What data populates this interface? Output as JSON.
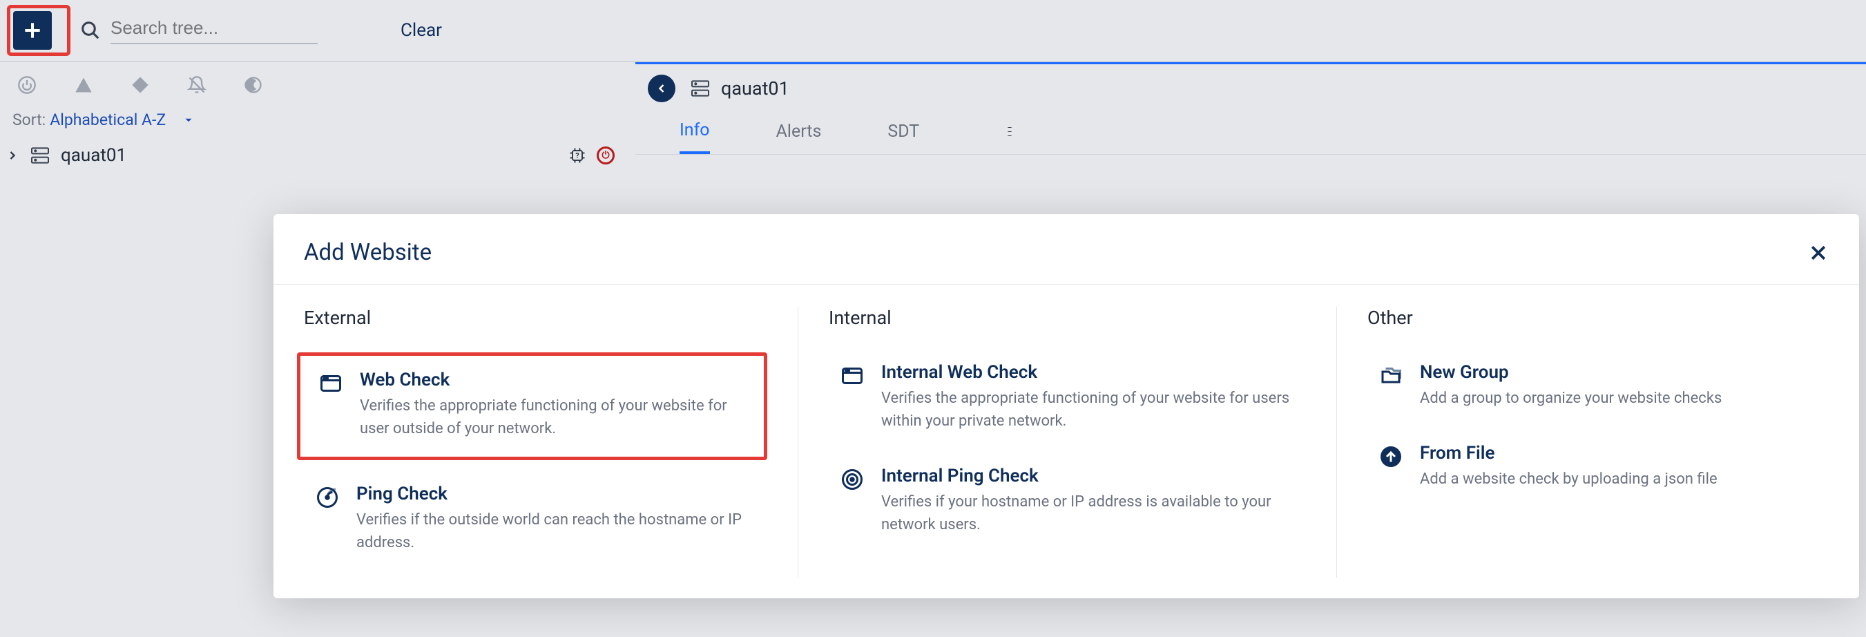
{
  "toolbar": {
    "search_placeholder": "Search tree...",
    "clear_label": "Clear"
  },
  "sort": {
    "label": "Sort:",
    "value": "Alphabetical A-Z"
  },
  "tree": {
    "items": [
      {
        "label": "qauat01"
      }
    ]
  },
  "main": {
    "title": "qauat01",
    "tabs": [
      {
        "label": "Info",
        "active": true
      },
      {
        "label": "Alerts",
        "active": false
      },
      {
        "label": "SDT",
        "active": false
      }
    ]
  },
  "modal": {
    "title": "Add Website",
    "columns": {
      "external": {
        "heading": "External",
        "options": [
          {
            "title": "Web Check",
            "desc": "Verifies the appropriate functioning of your website for user outside of your network.",
            "highlighted": true
          },
          {
            "title": "Ping Check",
            "desc": "Verifies if the outside world can reach the hostname or IP address.",
            "highlighted": false
          }
        ]
      },
      "internal": {
        "heading": "Internal",
        "options": [
          {
            "title": "Internal Web Check",
            "desc": "Verifies the appropriate functioning of your website for users within your private network."
          },
          {
            "title": "Internal Ping Check",
            "desc": "Verifies if your hostname or IP address is available to your network users."
          }
        ]
      },
      "other": {
        "heading": "Other",
        "options": [
          {
            "title": "New Group",
            "desc": "Add a group to organize your website checks"
          },
          {
            "title": "From File",
            "desc": "Add a website check by uploading a json file"
          }
        ]
      }
    }
  }
}
